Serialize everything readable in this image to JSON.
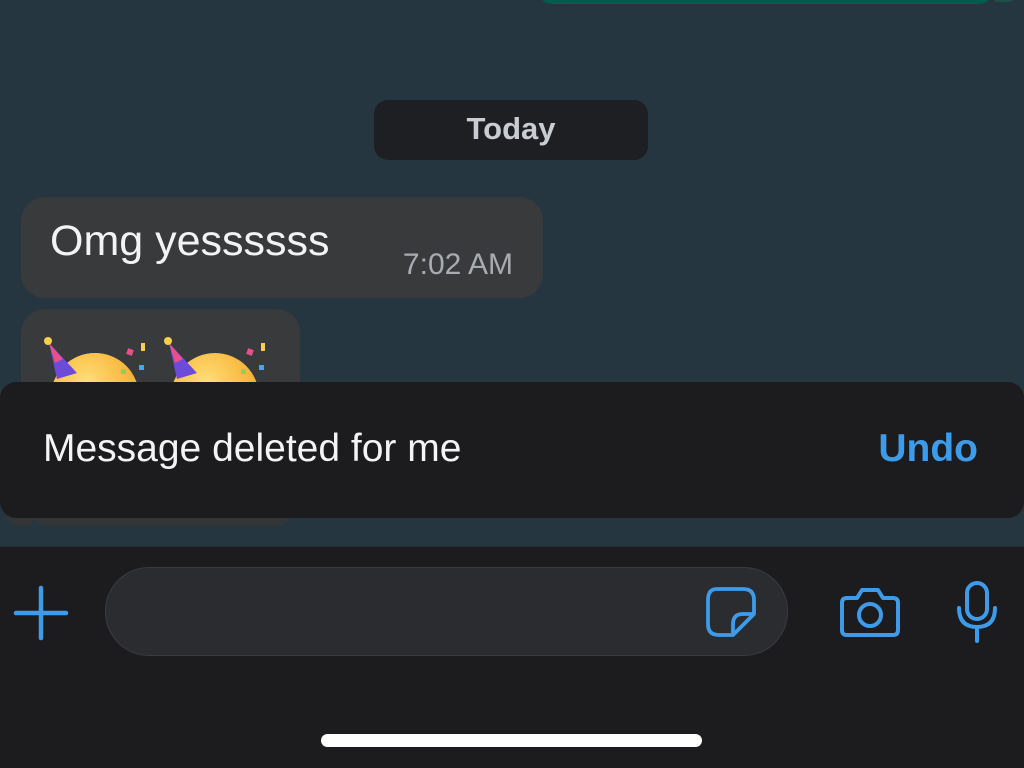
{
  "chat": {
    "date_separator": "Today",
    "messages": [
      {
        "text": "Omg yessssss",
        "time": "7:02 AM"
      },
      {
        "content": "partying-face-emoji x2"
      }
    ]
  },
  "toast": {
    "message": "Message deleted for me",
    "action": "Undo"
  },
  "composer": {
    "value": "",
    "placeholder": ""
  },
  "icons": {
    "attach": "plus-icon",
    "sticker": "sticker-icon",
    "camera": "camera-icon",
    "mic": "microphone-icon"
  },
  "colors": {
    "chat_background": "#263640",
    "bubble_incoming": "#393a3c",
    "bar_background": "#1c1c1e",
    "accent": "#3d9be9",
    "outgoing_bubble": "#005c4b"
  }
}
